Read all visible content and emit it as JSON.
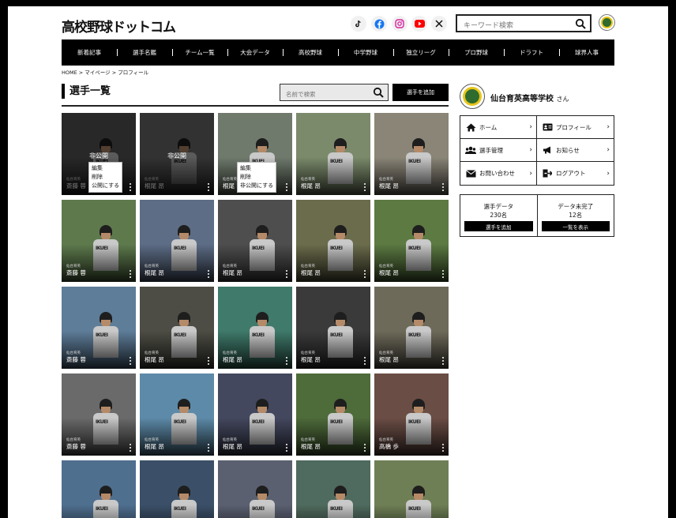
{
  "header": {
    "logo_text": "高校野球ドットコム",
    "search_placeholder": "キーワード検索",
    "social_icons": [
      "tiktok-icon",
      "facebook-icon",
      "instagram-icon",
      "youtube-icon",
      "x-icon"
    ]
  },
  "nav": {
    "items": [
      "新着記事",
      "選手名鑑",
      "チーム一覧",
      "大会データ",
      "高校野球",
      "中学野球",
      "独立リーグ",
      "プロ野球",
      "ドラフト",
      "球界人事"
    ]
  },
  "breadcrumb": "HOME > マイページ > プロフィール",
  "main": {
    "title": "選手一覧",
    "search_placeholder": "名前で検索",
    "add_button": "選手を追加",
    "private_label": "非公開",
    "menu_private": [
      "編集",
      "削除",
      "公開にする"
    ],
    "menu_public": [
      "編集",
      "削除",
      "非公開にする"
    ],
    "cards": [
      {
        "school": "仙台育英",
        "name": "斎藤 蓉",
        "private": true,
        "menu": "private",
        "bg": "#5a5a5a"
      },
      {
        "school": "仙台育英",
        "name": "根尾 昂",
        "private": true,
        "menu": "",
        "bg": "#707070"
      },
      {
        "school": "仙台育英",
        "name": "根尾 昂",
        "private": false,
        "menu": "public",
        "bg": "#6f7a6c"
      },
      {
        "school": "仙台育英",
        "name": "根尾 昂",
        "private": false,
        "menu": "",
        "bg": "#7b8a6b"
      },
      {
        "school": "仙台育英",
        "name": "根尾 昂",
        "private": false,
        "menu": "",
        "bg": "#8a8577"
      },
      {
        "school": "仙台育英",
        "name": "斎藤 蓉",
        "private": false,
        "menu": "",
        "bg": "#5e7a4d"
      },
      {
        "school": "仙台育英",
        "name": "根尾 昂",
        "private": false,
        "menu": "",
        "bg": "#5d6d86"
      },
      {
        "school": "仙台育英",
        "name": "根尾 昂",
        "private": false,
        "menu": "",
        "bg": "#4e4e4e"
      },
      {
        "school": "仙台育英",
        "name": "根尾 昂",
        "private": false,
        "menu": "",
        "bg": "#6b6c4c"
      },
      {
        "school": "仙台育英",
        "name": "根尾 昂",
        "private": false,
        "menu": "",
        "bg": "#5c7a42"
      },
      {
        "school": "仙台育英",
        "name": "斎藤 蓉",
        "private": false,
        "menu": "",
        "bg": "#5e7d99"
      },
      {
        "school": "仙台育英",
        "name": "根尾 昂",
        "private": false,
        "menu": "",
        "bg": "#4d4d45"
      },
      {
        "school": "仙台育英",
        "name": "根尾 昂",
        "private": false,
        "menu": "",
        "bg": "#3f7a6a"
      },
      {
        "school": "仙台育英",
        "name": "根尾 昂",
        "private": false,
        "menu": "",
        "bg": "#3a3a3a"
      },
      {
        "school": "仙台育英",
        "name": "根尾 昂",
        "private": false,
        "menu": "",
        "bg": "#6e6a5a"
      },
      {
        "school": "仙台育英",
        "name": "斎藤 蓉",
        "private": false,
        "menu": "",
        "bg": "#6a6a6a"
      },
      {
        "school": "仙台育英",
        "name": "根尾 昂",
        "private": false,
        "menu": "",
        "bg": "#5d8aa8"
      },
      {
        "school": "仙台育英",
        "name": "根尾 昂",
        "private": false,
        "menu": "",
        "bg": "#44485e"
      },
      {
        "school": "仙台育英",
        "name": "根尾 昂",
        "private": false,
        "menu": "",
        "bg": "#4e6b3a"
      },
      {
        "school": "仙台育英",
        "name": "高橋 歩",
        "private": false,
        "menu": "",
        "bg": "#6a4d45"
      },
      {
        "school": "",
        "name": "",
        "private": false,
        "menu": "",
        "bg": "#4f6f8f"
      },
      {
        "school": "",
        "name": "",
        "private": false,
        "menu": "",
        "bg": "#3b5068"
      },
      {
        "school": "",
        "name": "",
        "private": false,
        "menu": "",
        "bg": "#5a6070"
      },
      {
        "school": "",
        "name": "",
        "private": false,
        "menu": "",
        "bg": "#4f6a5e"
      },
      {
        "school": "",
        "name": "",
        "private": false,
        "menu": "",
        "bg": "#6f7f55"
      }
    ]
  },
  "sidebar": {
    "school_name": "仙台育英高等学校",
    "honorific": "さん",
    "menu": [
      {
        "label": "ホーム",
        "icon": "home-icon"
      },
      {
        "label": "プロフィール",
        "icon": "id-card-icon"
      },
      {
        "label": "選手管理",
        "icon": "users-icon"
      },
      {
        "label": "お知らせ",
        "icon": "megaphone-icon"
      },
      {
        "label": "お問い合わせ",
        "icon": "mail-icon"
      },
      {
        "label": "ログアウト",
        "icon": "logout-icon"
      }
    ],
    "stats": [
      {
        "label": "選手データ",
        "count": "230名",
        "button": "選手を追加"
      },
      {
        "label": "データ未完了",
        "count": "12名",
        "button": "一覧を表示"
      }
    ]
  }
}
